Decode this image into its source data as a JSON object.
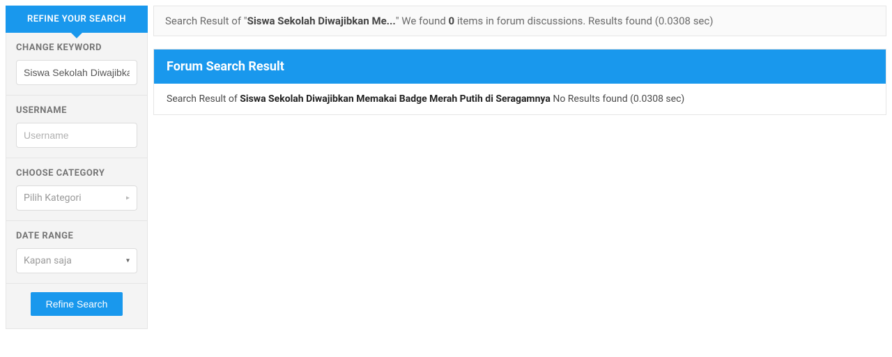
{
  "sidebar": {
    "header": "REFINE YOUR SEARCH",
    "keyword_label": "CHANGE KEYWORD",
    "keyword_value": "Siswa Sekolah Diwajibkan Memakai Badge Merah Putih di Seragamnya",
    "username_label": "USERNAME",
    "username_placeholder": "Username",
    "category_label": "CHOOSE CATEGORY",
    "category_selected": "Pilih Kategori",
    "daterange_label": "DATE RANGE",
    "daterange_selected": "Kapan saja",
    "refine_button": "Refine Search"
  },
  "summary": {
    "prefix": "Search Result of \"",
    "query_truncated": "Siswa Sekolah Diwajibkan Me...",
    "mid": "\" We found ",
    "count": "0",
    "suffix": " items in forum discussions. Results found (0.0308 sec)"
  },
  "panel": {
    "title": "Forum Search Result",
    "body_prefix": "Search Result of ",
    "body_query": "Siswa Sekolah Diwajibkan Memakai Badge Merah Putih di Seragamnya",
    "body_suffix": " No Results found (0.0308 sec)"
  }
}
